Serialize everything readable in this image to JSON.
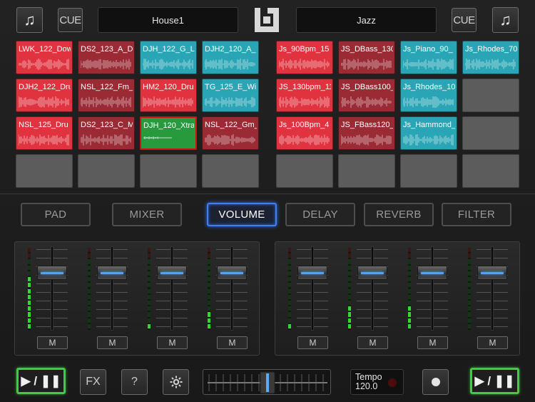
{
  "header": {
    "left_music_icon": "music-note-icon",
    "left_cue": "CUE",
    "left_deck_name": "House1",
    "logo_icon": "app-logo-icon",
    "right_deck_name": "Jazz",
    "right_cue": "CUE",
    "right_music_icon": "music-note-icon"
  },
  "colors": {
    "pad_red": "#e0333f",
    "pad_dark_red": "#9a2a34",
    "pad_blue": "#2aa5b5",
    "pad_green": "#269a3c",
    "pad_empty": "#5c5c5c",
    "accent_blue": "#3f7ff0",
    "play_green": "#3bcf3b",
    "meter_green": "#33d633"
  },
  "left_pads": [
    {
      "label": "LWK_122_Dow",
      "color": "red"
    },
    {
      "label": "DS2_123_A_D",
      "color": "dark"
    },
    {
      "label": "DJH_122_G_L",
      "color": "blue"
    },
    {
      "label": "DJH2_120_A_",
      "color": "blue"
    },
    {
      "label": "DJH2_122_Dru",
      "color": "red"
    },
    {
      "label": "NSL_122_Fm_",
      "color": "dark"
    },
    {
      "label": "HM2_120_Dru",
      "color": "red"
    },
    {
      "label": "TG_125_E_Wi",
      "color": "blue"
    },
    {
      "label": "NSL_125_Dru",
      "color": "red"
    },
    {
      "label": "DS2_123_C_M",
      "color": "dark"
    },
    {
      "label": "DJH_120_Xtra",
      "color": "green"
    },
    {
      "label": "NSL_122_Gm_",
      "color": "dark"
    },
    {
      "label": "",
      "color": "empty"
    },
    {
      "label": "",
      "color": "empty"
    },
    {
      "label": "",
      "color": "empty"
    },
    {
      "label": "",
      "color": "empty"
    }
  ],
  "right_pads": [
    {
      "label": "Js_90Bpm_15",
      "color": "red"
    },
    {
      "label": "JS_DBass_130",
      "color": "dark"
    },
    {
      "label": "Js_Piano_90_",
      "color": "blue"
    },
    {
      "label": "Js_Rhodes_70",
      "color": "blue"
    },
    {
      "label": "JS_130bpm_11",
      "color": "red"
    },
    {
      "label": "JS_DBass100_",
      "color": "dark"
    },
    {
      "label": "Js_Rhodes_10",
      "color": "blue"
    },
    {
      "label": "",
      "color": "empty"
    },
    {
      "label": "Js_100Bpm_4",
      "color": "red"
    },
    {
      "label": "JS_FBass120_",
      "color": "dark"
    },
    {
      "label": "Js_Hammond_",
      "color": "blue"
    },
    {
      "label": "",
      "color": "empty"
    },
    {
      "label": "",
      "color": "empty"
    },
    {
      "label": "",
      "color": "empty"
    },
    {
      "label": "",
      "color": "empty"
    },
    {
      "label": "",
      "color": "empty"
    }
  ],
  "modes": [
    "PAD",
    "MIXER",
    "VOLUME",
    "DELAY",
    "REVERB",
    "FILTER"
  ],
  "active_mode": "VOLUME",
  "mixer": {
    "mute_label": "M",
    "left_levels": [
      0.62,
      0.0,
      0.08,
      0.22
    ],
    "right_levels": [
      0.08,
      0.32,
      0.32,
      0.0
    ],
    "left_faders": [
      0.72,
      0.72,
      0.72,
      0.72
    ],
    "right_faders": [
      0.72,
      0.72,
      0.72,
      0.72
    ]
  },
  "footer": {
    "play_left": "▶ / ❚❚",
    "fx": "FX",
    "help": "?",
    "settings_icon": "gear-icon",
    "crossfader_position": 0.5,
    "tempo_label": "Tempo",
    "tempo_value": "120.0",
    "record_icon": "record-icon",
    "play_right": "▶ / ❚❚"
  }
}
